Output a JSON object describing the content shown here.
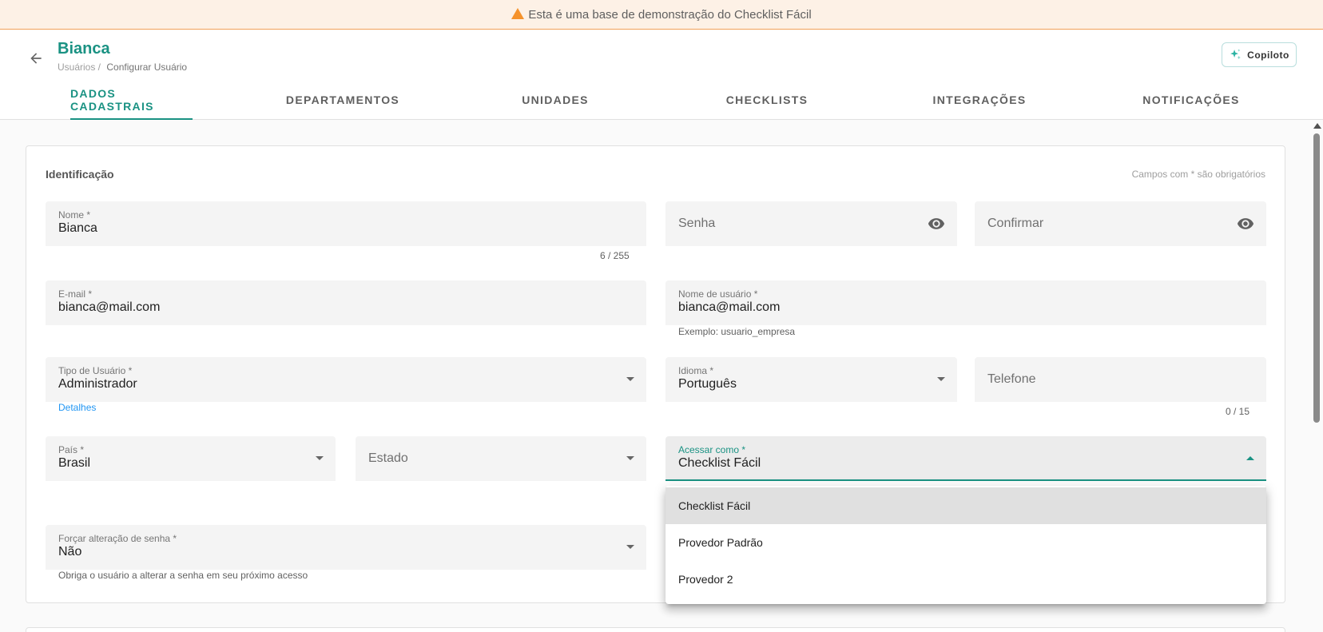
{
  "banner": {
    "text": "Esta é uma base de demonstração do Checklist Fácil",
    "icon": "warning-icon",
    "color": "#f5922b"
  },
  "header": {
    "title": "Bianca",
    "breadcrumb": {
      "parent": "Usuários /",
      "current": "Configurar Usuário"
    },
    "copilot_label": "Copiloto",
    "accent_color": "#1a9283"
  },
  "tabs": [
    {
      "label": "DADOS CADASTRAIS",
      "active": true
    },
    {
      "label": "DEPARTAMENTOS",
      "active": false
    },
    {
      "label": "UNIDADES",
      "active": false
    },
    {
      "label": "CHECKLISTS",
      "active": false
    },
    {
      "label": "INTEGRAÇÕES",
      "active": false
    },
    {
      "label": "NOTIFICAÇÕES",
      "active": false
    }
  ],
  "form": {
    "section_title": "Identificação",
    "required_note": "Campos com * são obrigatórios",
    "nome": {
      "label": "Nome *",
      "value": "Bianca",
      "counter": "6 / 255"
    },
    "senha": {
      "placeholder": "Senha"
    },
    "confirmar": {
      "placeholder": "Confirmar"
    },
    "email": {
      "label": "E-mail *",
      "value": "bianca@mail.com"
    },
    "username": {
      "label": "Nome de usuário *",
      "value": "bianca@mail.com",
      "hint": "Exemplo: usuario_empresa"
    },
    "tipo_usuario": {
      "label": "Tipo de Usuário *",
      "value": "Administrador",
      "link": "Detalhes"
    },
    "idioma": {
      "label": "Idioma *",
      "value": "Português"
    },
    "telefone": {
      "placeholder": "Telefone",
      "counter": "0 / 15"
    },
    "pais": {
      "label": "País *",
      "value": "Brasil"
    },
    "estado": {
      "placeholder": "Estado"
    },
    "acessar_como": {
      "label": "Acessar como *",
      "value": "Checklist Fácil"
    },
    "forcar_senha": {
      "label": "Forçar alteração de senha *",
      "value": "Não",
      "hint": "Obriga o usuário a alterar a senha em seu próximo acesso"
    }
  },
  "dropdown": {
    "options": [
      {
        "label": "Checklist Fácil",
        "selected": true
      },
      {
        "label": "Provedor Padrão",
        "selected": false
      },
      {
        "label": "Provedor 2",
        "selected": false
      }
    ]
  }
}
